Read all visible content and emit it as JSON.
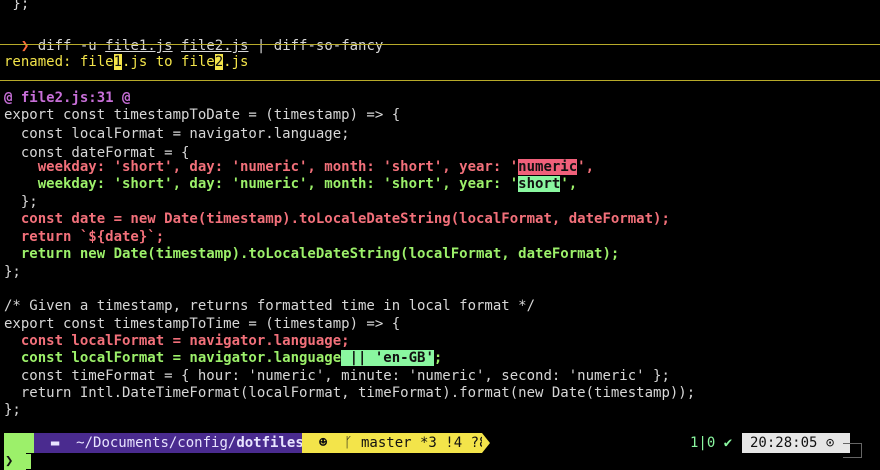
{
  "top": {
    "close_brace": " };"
  },
  "command": {
    "arrow": "❯",
    "cmd": "diff -u ",
    "file1": "file1.js",
    "space": " ",
    "file2": "file2.js",
    "pipe": " | diff-so-fancy"
  },
  "rename": {
    "prefix": "renamed: file",
    "n1": "1",
    "mid": ".js to file",
    "n2": "2",
    "suffix": ".js"
  },
  "hunk": {
    "header": "@ file2.js:31 @"
  },
  "code": {
    "l1": "export const timestampToDate = (timestamp) => {",
    "l2": "  const localFormat = navigator.language;",
    "l3": "  const dateFormat = {",
    "l4a": "    weekday: 'short', day: 'numeric', month: 'short', year: '",
    "l4b": "numeric",
    "l4c": "',",
    "l5a": "    weekday: 'short', day: 'numeric', month: 'short', year: '",
    "l5b": "short",
    "l5c": "',",
    "l6": "  };",
    "l7": "  const date = new Date(timestamp).toLocaleDateString(localFormat, dateFormat);",
    "l8": "  return `${date}`;",
    "l9": "  return new Date(timestamp).toLocaleDateString(localFormat, dateFormat);",
    "l10": "};",
    "l12": "/* Given a timestamp, returns formatted time in local format */",
    "l13": "export const timestampToTime = (timestamp) => {",
    "l14": "  const localFormat = navigator.language;",
    "l15a": "  const localFormat = navigator.language",
    "l15b": " || 'en-GB'",
    "l15c": ";",
    "l16": "  const timeFormat = { hour: 'numeric', minute: 'numeric', second: 'numeric' };",
    "l17": "  return Intl.DateTimeFormat(localFormat, timeFormat).format(new Date(timestamp));",
    "l18": "};"
  },
  "status": {
    "apple_icon": "",
    "folder_icon": "▬",
    "path": "~/Documents/config/",
    "dir": "dotfiles",
    "git_icon": "☻",
    "branch_icon": "ᚴ",
    "branch": "master *3 !4 ?8",
    "jobs": "1|0 ✔",
    "time": "20:28:05 ⊙"
  },
  "prompt": {
    "arrow": "❯"
  },
  "colors": {
    "removed": "#f2707a",
    "added": "#9cf06a",
    "rule": "#b7aa2a",
    "hunk": "#c86fd8",
    "status_dir_bg": "#4a2b8f",
    "status_git_bg": "#f3e44a"
  }
}
